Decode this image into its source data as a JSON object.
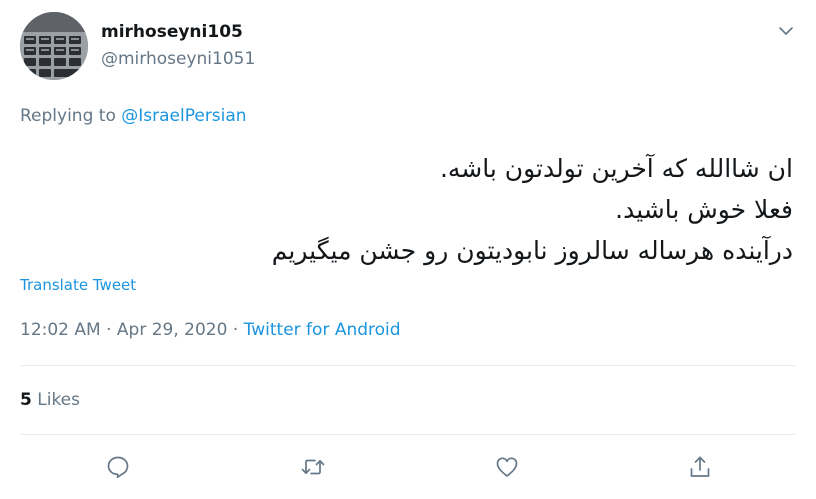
{
  "user": {
    "display_name": "mirhoseyni105",
    "handle": "@mirhoseyni1051"
  },
  "reply": {
    "prefix": "Replying to ",
    "target": "@IsraelPersian"
  },
  "tweet": {
    "lines": [
      "ان شاالله که آخرین تولدتون باشه.",
      "فعلا خوش باشید.",
      "درآینده هرساله سالروز نابودیتون رو جشن میگیریم"
    ]
  },
  "translate_label": "Translate Tweet",
  "meta": {
    "time": "12:02 AM",
    "separator": " · ",
    "date": "Apr 29, 2020",
    "source": "Twitter for Android"
  },
  "stats": {
    "likes_count": "5",
    "likes_label": "Likes"
  },
  "icons": {
    "caret": "chevron-down-icon",
    "reply": "reply-icon",
    "retweet": "retweet-icon",
    "like": "heart-icon",
    "share": "share-icon"
  },
  "colors": {
    "link": "#1b95e0",
    "secondary_text": "#657786",
    "primary_text": "#14171a",
    "divider": "#e6ecf0"
  }
}
